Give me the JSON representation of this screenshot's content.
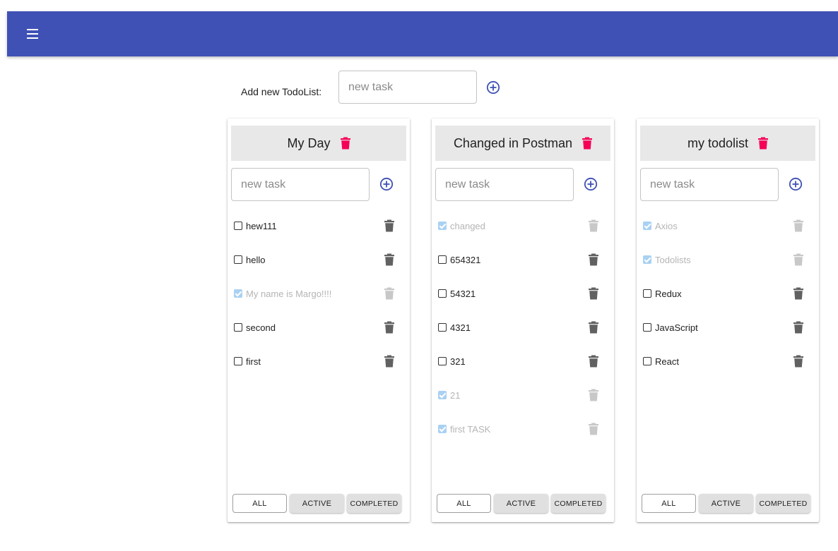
{
  "appbar": {
    "color": "#3f51b5",
    "menu_icon": "menu-icon"
  },
  "add_todolist": {
    "label": "Add new TodoList:",
    "placeholder": "new task",
    "value": ""
  },
  "todolists": [
    {
      "title": "My Day",
      "input_placeholder": "new task",
      "tasks": [
        {
          "title": "hew111",
          "done": false
        },
        {
          "title": "hello",
          "done": false
        },
        {
          "title": "My name is Margo!!!!",
          "done": true
        },
        {
          "title": "second",
          "done": false
        },
        {
          "title": "first",
          "done": false
        }
      ],
      "filters": {
        "all": "ALL",
        "active": "ACTIVE",
        "completed": "COMPLETED",
        "selected": "all"
      }
    },
    {
      "title": "Changed in Postman",
      "input_placeholder": "new task",
      "tasks": [
        {
          "title": "changed",
          "done": true
        },
        {
          "title": "654321",
          "done": false
        },
        {
          "title": "54321",
          "done": false
        },
        {
          "title": "4321",
          "done": false
        },
        {
          "title": "321",
          "done": false
        },
        {
          "title": "21",
          "done": true
        },
        {
          "title": "first TASK",
          "done": true
        }
      ],
      "filters": {
        "all": "ALL",
        "active": "ACTIVE",
        "completed": "COMPLETED",
        "selected": "all"
      }
    },
    {
      "title": "my todolist",
      "input_placeholder": "new task",
      "tasks": [
        {
          "title": "Axios",
          "done": true
        },
        {
          "title": "Todolists",
          "done": true
        },
        {
          "title": "Redux",
          "done": false
        },
        {
          "title": "JavaScript",
          "done": false
        },
        {
          "title": "React",
          "done": false
        }
      ],
      "filters": {
        "all": "ALL",
        "active": "ACTIVE",
        "completed": "COMPLETED",
        "selected": "all"
      }
    }
  ],
  "colors": {
    "primary": "#3f51b5",
    "delete_list": "#f50057",
    "delete_task": "#616161",
    "delete_task_disabled": "#c8c8c8",
    "done_text": "#b5b5b5"
  }
}
